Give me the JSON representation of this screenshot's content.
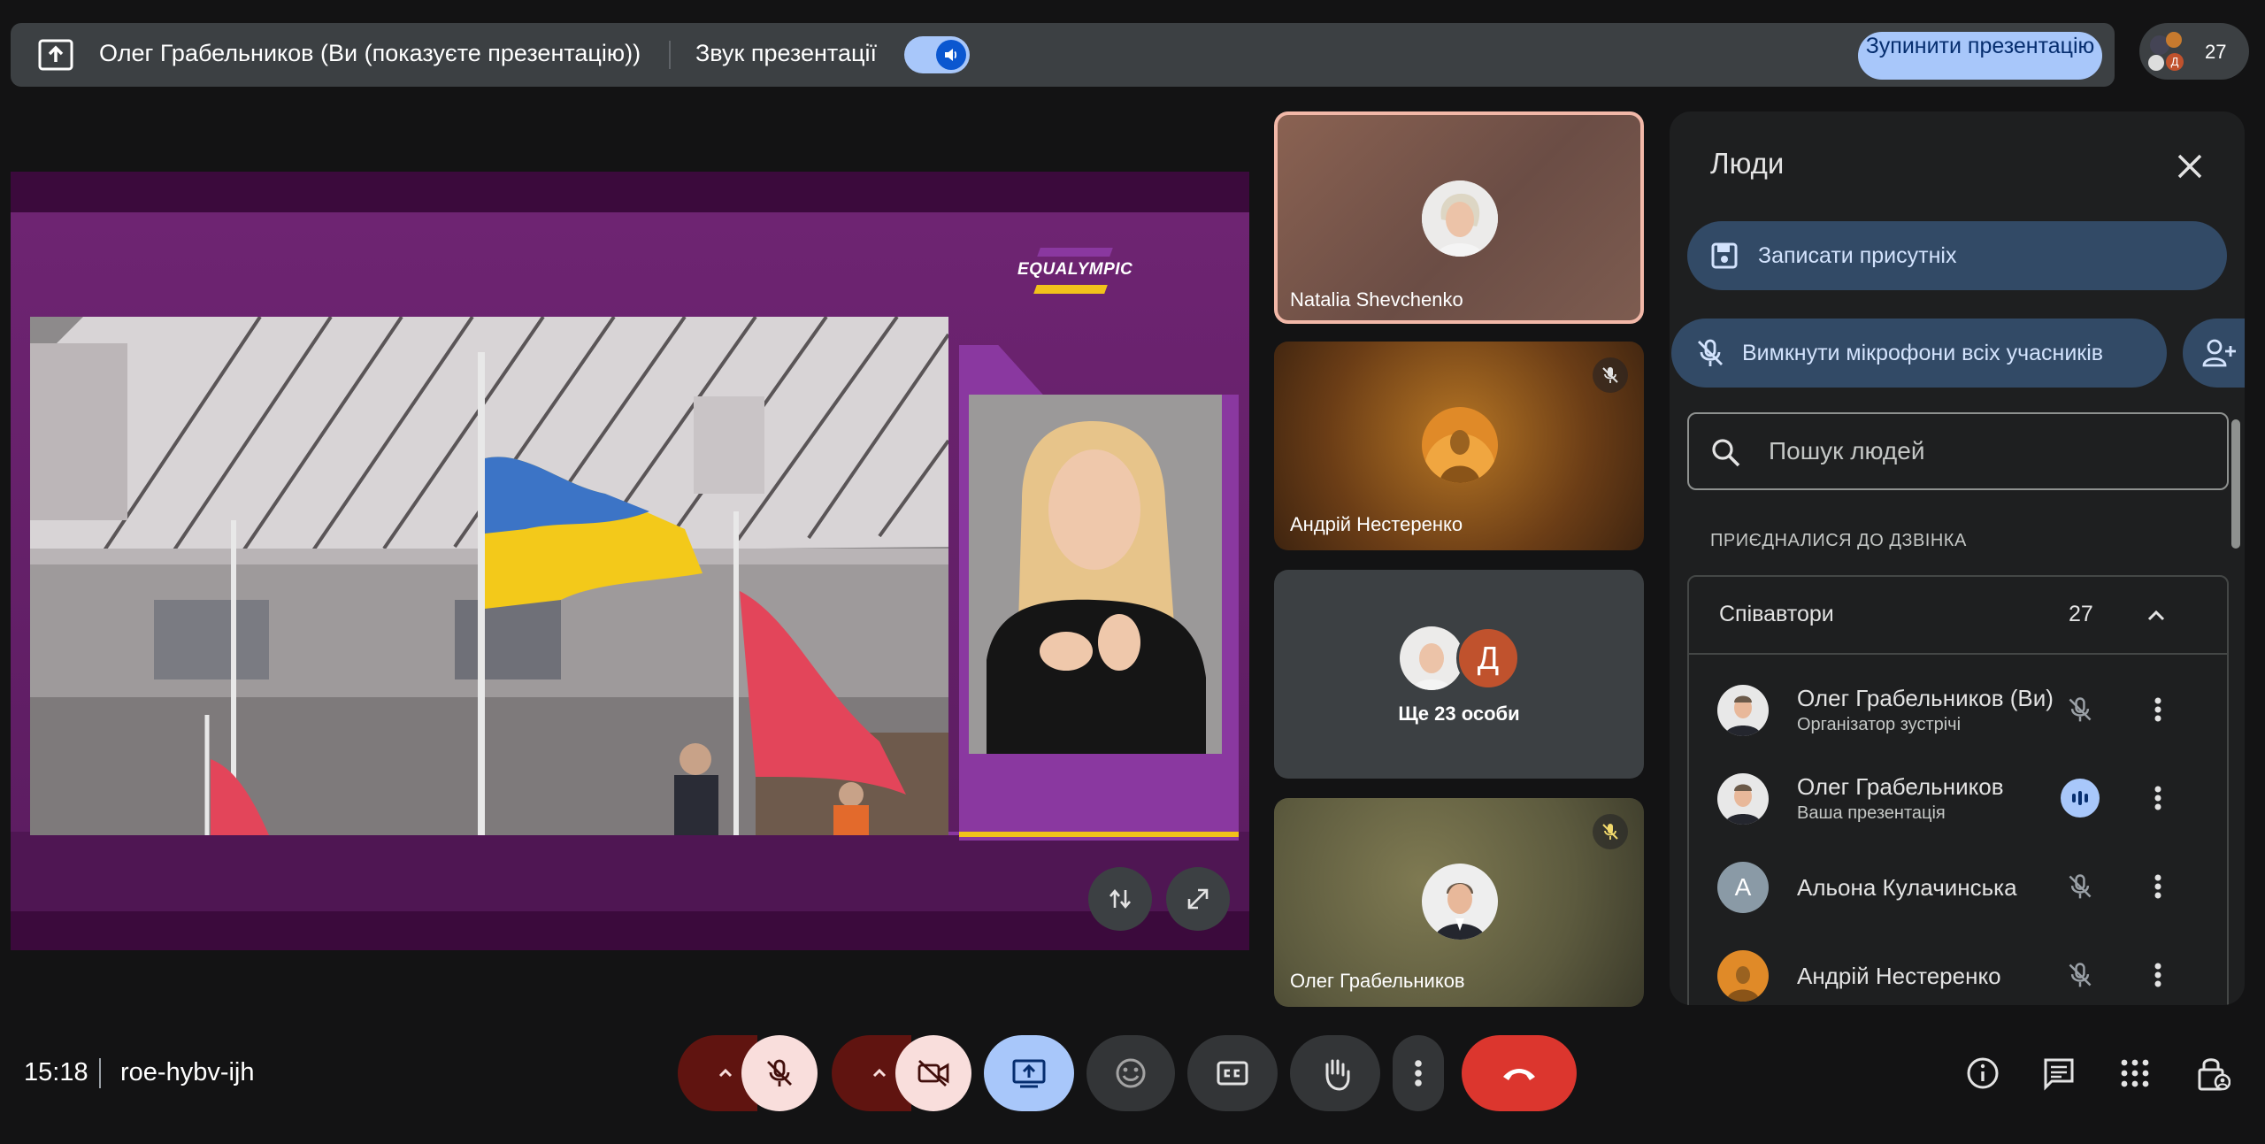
{
  "banner": {
    "title": "Олег Грабельников (Ви (показуєте презентацію))",
    "audio_label": "Звук презентації",
    "stop_button": "Зупинити презентацію"
  },
  "people_chip": {
    "count": "27",
    "avatar_letter": "Д"
  },
  "presentation": {
    "logo_text": "EQUALYMPIC"
  },
  "tiles": [
    {
      "name": "Natalia Shevchenko",
      "muted": false
    },
    {
      "name": "Андрій Нестеренко",
      "muted": true
    },
    {
      "label": "Ще 23 особи",
      "avatar_letter": "Д"
    },
    {
      "name": "Олег Грабельников",
      "muted": true
    }
  ],
  "panel": {
    "title": "Люди",
    "record_button": "Записати присутніх",
    "mute_all_button": "Вимкнути мікрофони всіх учасників",
    "search_placeholder": "Пошук людей",
    "section_title": "ПРИЄДНАЛИСЯ ДО ДЗВІНКА",
    "group_name": "Співавтори",
    "group_count": "27",
    "participants": [
      {
        "name": "Олег Грабельников (Ви)",
        "subtitle": "Організатор зустрічі",
        "mic": "muted"
      },
      {
        "name": "Олег Грабельников",
        "subtitle": "Ваша презентація",
        "mic": "speaking"
      },
      {
        "name": "Альона Кулачинська",
        "subtitle": "",
        "mic": "muted",
        "avatar_letter": "А"
      },
      {
        "name": "Андрій Нестеренко",
        "subtitle": "",
        "mic": "muted"
      }
    ]
  },
  "bottom": {
    "time": "15:18",
    "meeting_code": "roe-hybv-ijh"
  },
  "colors": {
    "accent": "#a8c7fa",
    "end_call": "#dc362e",
    "panel_bg": "#1e1f20",
    "active_tile_border": "#f2b8a8"
  }
}
